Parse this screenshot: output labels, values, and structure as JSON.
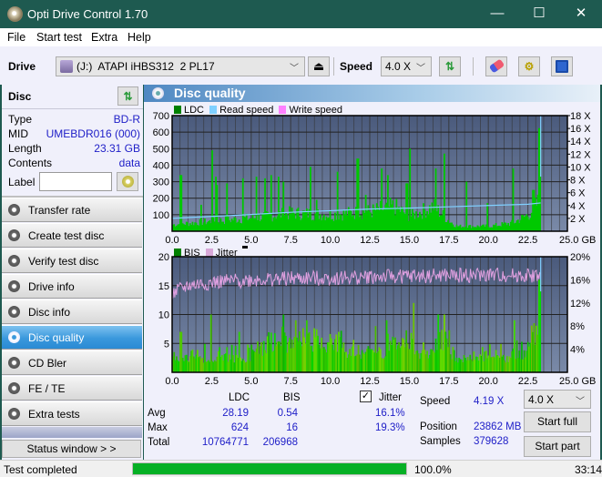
{
  "window": {
    "title": "Opti Drive Control 1.70",
    "minimize_label": "—",
    "maximize_label": "☐",
    "close_label": "✕"
  },
  "menu": [
    "File",
    "Start test",
    "Extra",
    "Help"
  ],
  "toolbar": {
    "drive_label": "Drive",
    "drive_value": "(J:)  ATAPI iHBS312  2 PL17",
    "speed_label": "Speed",
    "speed_value": "4.0 X",
    "icons": [
      "eject-icon",
      "refresh-icon",
      "erase-icon",
      "settings-icon",
      "save-icon"
    ]
  },
  "disc": {
    "header": "Disc",
    "rows": [
      {
        "key": "Type",
        "value": "BD-R"
      },
      {
        "key": "MID",
        "value": "UMEBDR016 (000)"
      },
      {
        "key": "Length",
        "value": "23.31 GB"
      },
      {
        "key": "Contents",
        "value": "data"
      }
    ],
    "label_key": "Label",
    "label_value": ""
  },
  "nav": [
    {
      "label": "Transfer rate",
      "active": false
    },
    {
      "label": "Create test disc",
      "active": false
    },
    {
      "label": "Verify test disc",
      "active": false
    },
    {
      "label": "Drive info",
      "active": false
    },
    {
      "label": "Disc info",
      "active": false
    },
    {
      "label": "Disc quality",
      "active": true
    },
    {
      "label": "CD Bler",
      "active": false
    },
    {
      "label": "FE / TE",
      "active": false
    },
    {
      "label": "Extra tests",
      "active": false
    }
  ],
  "status_window_label": "Status window > >",
  "panel_title": "Disc quality",
  "colors": {
    "ldc": "#00c800",
    "bis": "#00c800",
    "read_speed": "#80d0ff",
    "write_speed": "#ff80ff",
    "jitter": "#e0a0e0",
    "plot_bg_top": "#4a5a7c",
    "plot_bg_bottom": "#7a8aa8",
    "accent_blue": "#2020c8",
    "progress": "#06b025"
  },
  "chart_data": [
    {
      "type": "bar",
      "title": "LDC / Read speed",
      "legend": [
        "LDC",
        "Read speed",
        "Write speed"
      ],
      "legend_position": "top-left",
      "xlabel": "GB",
      "x_ticks": [
        "0.0",
        "2.5",
        "5.0",
        "7.5",
        "10.0",
        "12.5",
        "15.0",
        "17.5",
        "20.0",
        "22.5",
        "25.0 GB"
      ],
      "xlim": [
        0,
        25
      ],
      "y_ticks_left": [
        "100",
        "200",
        "300",
        "400",
        "500",
        "600",
        "700"
      ],
      "ylim_left": [
        0,
        700
      ],
      "y_ticks_right": [
        "2 X",
        "4 X",
        "6 X",
        "8 X",
        "10 X",
        "12 X",
        "14 X",
        "16 X",
        "18 X"
      ],
      "ylim_right": [
        0,
        18
      ],
      "grid": true,
      "ldc_peaks": [
        {
          "x": 0.5,
          "y": 340
        },
        {
          "x": 1.8,
          "y": 160
        },
        {
          "x": 2.5,
          "y": 490
        },
        {
          "x": 2.7,
          "y": 330
        },
        {
          "x": 2.8,
          "y": 280
        },
        {
          "x": 3.4,
          "y": 290
        },
        {
          "x": 4.4,
          "y": 320
        },
        {
          "x": 5.3,
          "y": 330
        },
        {
          "x": 5.8,
          "y": 320
        },
        {
          "x": 6.2,
          "y": 340
        },
        {
          "x": 6.7,
          "y": 330
        },
        {
          "x": 7.0,
          "y": 300
        },
        {
          "x": 8.7,
          "y": 390
        },
        {
          "x": 9.1,
          "y": 190
        },
        {
          "x": 10.4,
          "y": 360
        },
        {
          "x": 11.7,
          "y": 440
        },
        {
          "x": 12.2,
          "y": 220
        },
        {
          "x": 13.2,
          "y": 380
        },
        {
          "x": 13.6,
          "y": 340
        },
        {
          "x": 14.8,
          "y": 290
        },
        {
          "x": 15.0,
          "y": 500
        },
        {
          "x": 16.6,
          "y": 380
        },
        {
          "x": 17.2,
          "y": 470
        },
        {
          "x": 18.6,
          "y": 300
        },
        {
          "x": 19.9,
          "y": 170
        },
        {
          "x": 21.5,
          "y": 380
        },
        {
          "x": 22.8,
          "y": 250
        },
        {
          "x": 23.2,
          "y": 624
        },
        {
          "x": 23.4,
          "y": 360
        }
      ],
      "ldc_baseline": [
        {
          "x": 0,
          "y": 40
        },
        {
          "x": 2.5,
          "y": 60
        },
        {
          "x": 5,
          "y": 80
        },
        {
          "x": 7.5,
          "y": 110
        },
        {
          "x": 10,
          "y": 100
        },
        {
          "x": 12.5,
          "y": 120
        },
        {
          "x": 14,
          "y": 150
        },
        {
          "x": 15,
          "y": 90
        },
        {
          "x": 16.5,
          "y": 150
        },
        {
          "x": 17.5,
          "y": 60
        },
        {
          "x": 18,
          "y": 30
        },
        {
          "x": 20,
          "y": 30
        },
        {
          "x": 21.5,
          "y": 50
        },
        {
          "x": 22.5,
          "y": 100
        },
        {
          "x": 23.31,
          "y": 200
        }
      ],
      "read_speed": [
        {
          "x": 0,
          "y": 2.0
        },
        {
          "x": 2.5,
          "y": 2.3
        },
        {
          "x": 5,
          "y": 2.6
        },
        {
          "x": 7.5,
          "y": 2.95
        },
        {
          "x": 10,
          "y": 3.2
        },
        {
          "x": 12.5,
          "y": 3.45
        },
        {
          "x": 15,
          "y": 3.6
        },
        {
          "x": 17.5,
          "y": 3.8
        },
        {
          "x": 20,
          "y": 4.0
        },
        {
          "x": 22.5,
          "y": 4.2
        },
        {
          "x": 23.31,
          "y": 4.4
        }
      ],
      "end_marker_x": 23.31
    },
    {
      "type": "bar",
      "title": "BIS / Jitter",
      "legend": [
        "BIS",
        "Jitter"
      ],
      "legend_position": "top-left",
      "xlabel": "GB",
      "x_ticks": [
        "0.0",
        "2.5",
        "5.0",
        "7.5",
        "10.0",
        "12.5",
        "15.0",
        "17.5",
        "20.0",
        "22.5",
        "25.0 GB"
      ],
      "xlim": [
        0,
        25
      ],
      "y_ticks_left": [
        "5",
        "10",
        "15",
        "20"
      ],
      "ylim_left": [
        0,
        20
      ],
      "y_ticks_right": [
        "4%",
        "8%",
        "12%",
        "16%",
        "20%"
      ],
      "ylim_right": [
        0,
        20
      ],
      "grid": true,
      "bis_levels": [
        {
          "x0": 0,
          "x1": 2.4,
          "y": 3
        },
        {
          "x0": 2.4,
          "x1": 5.0,
          "y": 3
        },
        {
          "x0": 5.0,
          "x1": 5.8,
          "y": 4
        },
        {
          "x0": 5.8,
          "x1": 11.0,
          "y": 6
        },
        {
          "x0": 11.0,
          "x1": 13.5,
          "y": 4
        },
        {
          "x0": 13.5,
          "x1": 15.2,
          "y": 6
        },
        {
          "x0": 15.2,
          "x1": 16.5,
          "y": 4
        },
        {
          "x0": 16.5,
          "x1": 17.5,
          "y": 6
        },
        {
          "x0": 17.5,
          "x1": 21.5,
          "y": 3
        },
        {
          "x0": 21.5,
          "x1": 22.5,
          "y": 4
        },
        {
          "x0": 22.5,
          "x1": 23.31,
          "y": 8
        }
      ],
      "bis_peaks": [
        {
          "x": 0.5,
          "y": 7
        },
        {
          "x": 2.4,
          "y": 10
        },
        {
          "x": 4.2,
          "y": 7
        },
        {
          "x": 7.0,
          "y": 10
        },
        {
          "x": 7.8,
          "y": 9
        },
        {
          "x": 8.5,
          "y": 9
        },
        {
          "x": 10.5,
          "y": 7
        },
        {
          "x": 12.8,
          "y": 8
        },
        {
          "x": 13.5,
          "y": 9
        },
        {
          "x": 15.2,
          "y": 12
        },
        {
          "x": 16.8,
          "y": 10
        },
        {
          "x": 17.2,
          "y": 10
        },
        {
          "x": 21.6,
          "y": 9
        },
        {
          "x": 23.2,
          "y": 16
        },
        {
          "x": 23.4,
          "y": 13
        }
      ],
      "jitter_mean": [
        {
          "x": 0,
          "y": 13.5
        },
        {
          "x": 1,
          "y": 15.0
        },
        {
          "x": 2.5,
          "y": 15.5
        },
        {
          "x": 5,
          "y": 16.0
        },
        {
          "x": 7.5,
          "y": 16.2
        },
        {
          "x": 10,
          "y": 16.3
        },
        {
          "x": 12.5,
          "y": 16.5
        },
        {
          "x": 15,
          "y": 16.6
        },
        {
          "x": 17.5,
          "y": 16.7
        },
        {
          "x": 20,
          "y": 16.8
        },
        {
          "x": 23.31,
          "y": 16.7
        }
      ],
      "end_marker_x": 23.31
    }
  ],
  "stats": {
    "col_ldc": "LDC",
    "col_bis": "BIS",
    "jitter_label": "Jitter",
    "jitter_checked": true,
    "rows": [
      {
        "label": "Avg",
        "ldc": "28.19",
        "bis": "0.54",
        "jitter": "16.1%"
      },
      {
        "label": "Max",
        "ldc": "624",
        "bis": "16",
        "jitter": "19.3%"
      },
      {
        "label": "Total",
        "ldc": "10764771",
        "bis": "206968",
        "jitter": ""
      }
    ],
    "speed_label": "Speed",
    "speed_value": "4.19 X",
    "position_label": "Position",
    "position_value": "23862 MB",
    "samples_label": "Samples",
    "samples_value": "379628",
    "speed_select": "4.0 X",
    "start_full_label": "Start full",
    "start_part_label": "Start part"
  },
  "statusbar": {
    "status_text": "Test completed",
    "progress_percent": 100.0,
    "progress_label": "100.0%",
    "elapsed": "33:14"
  }
}
